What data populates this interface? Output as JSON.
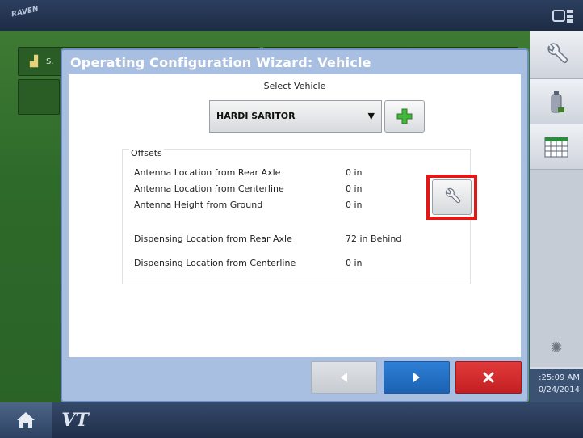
{
  "app": {
    "logo_text": "RAVEN"
  },
  "dialog": {
    "title": "Operating Configuration Wizard:  Vehicle",
    "select_vehicle_label": "Select Vehicle",
    "vehicle_selected": "HARDI SARITOR",
    "offsets_label": "Offsets",
    "offsets": [
      {
        "label": "Antenna Location from Rear Axle",
        "value": "0 in"
      },
      {
        "label": "Antenna Location from Centerline",
        "value": "0 in"
      },
      {
        "label": "Antenna Height from Ground",
        "value": "0 in"
      },
      {
        "label": "Dispensing Location from Rear Axle",
        "value": "72 in Behind"
      },
      {
        "label": "Dispensing Location from Centerline",
        "value": "0 in"
      }
    ]
  },
  "background": {
    "tile_label": "S."
  },
  "status": {
    "time": ":25:09 AM",
    "date": "0/24/2014"
  },
  "colors": {
    "highlight": "#e01818",
    "next": "#1c62b3",
    "cancel": "#c21f22",
    "dialog_header": "#a9bfe1"
  },
  "icons": [
    "home-icon",
    "vt-icon",
    "wrench-icon",
    "plus-icon",
    "arrow-left-icon",
    "arrow-right-icon",
    "close-icon",
    "calendar-grid-icon",
    "fuel-icon",
    "screen-icon"
  ],
  "bottom": {
    "vt_label": "VT"
  }
}
